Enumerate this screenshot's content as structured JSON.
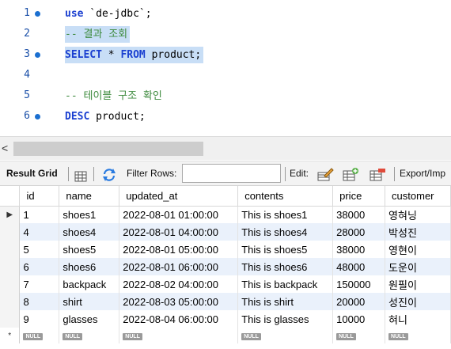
{
  "editor": {
    "lines": [
      {
        "num": "1",
        "dot": true,
        "text": "use `de-jdbc`;"
      },
      {
        "num": "2",
        "dot": false,
        "text": "-- 결과 조회"
      },
      {
        "num": "3",
        "dot": true,
        "text": "SELECT * FROM product;"
      },
      {
        "num": "4",
        "dot": false,
        "text": ""
      },
      {
        "num": "5",
        "dot": false,
        "text": "-- 테이블 구조 확인"
      },
      {
        "num": "6",
        "dot": true,
        "text": "DESC product;"
      }
    ],
    "tokens": {
      "l1_kw": "use",
      "l1_rest": " `de-jdbc`;",
      "l2": "-- 결과 조회",
      "l3_kw1": "SELECT",
      "l3_mid": " * ",
      "l3_kw2": "FROM",
      "l3_rest": " product;",
      "l5": "-- 테이블 구조 확인",
      "l6_kw": "DESC",
      "l6_rest": " product;"
    }
  },
  "scrollbar": {
    "left_arrow": "<"
  },
  "toolbar": {
    "result_grid": "Result Grid",
    "filter_rows": "Filter Rows:",
    "filter_value": "",
    "edit": "Edit:",
    "export": "Export/Imp"
  },
  "grid": {
    "columns": [
      "id",
      "name",
      "updated_at",
      "contents",
      "price",
      "customer"
    ],
    "rows": [
      [
        "1",
        "shoes1",
        "2022-08-01 01:00:00",
        "This is shoes1",
        "38000",
        "영혀닝"
      ],
      [
        "4",
        "shoes4",
        "2022-08-01 04:00:00",
        "This is shoes4",
        "28000",
        "박성진"
      ],
      [
        "5",
        "shoes5",
        "2022-08-01 05:00:00",
        "This is shoes5",
        "38000",
        "영현이"
      ],
      [
        "6",
        "shoes6",
        "2022-08-01 06:00:00",
        "This is shoes6",
        "48000",
        "도운이"
      ],
      [
        "7",
        "backpack",
        "2022-08-02 04:00:00",
        "This is backpack",
        "150000",
        "원필이"
      ],
      [
        "8",
        "shirt",
        "2022-08-03 05:00:00",
        "This is shirt",
        "20000",
        "성진이"
      ],
      [
        "9",
        "glasses",
        "2022-08-04 06:00:00",
        "This is glasses",
        "10000",
        "혀니"
      ]
    ],
    "null_label": "NULL",
    "current_row_marker": "▶",
    "new_row_marker": "*"
  }
}
